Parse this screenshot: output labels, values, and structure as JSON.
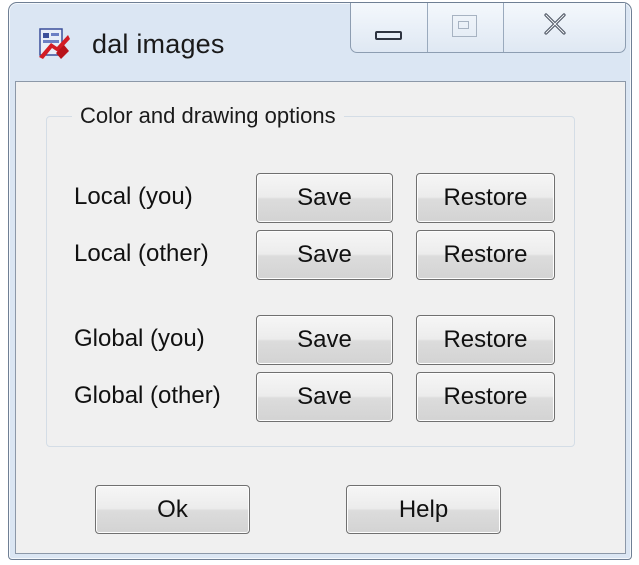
{
  "window": {
    "title": "dal images",
    "icon": "dal-app-icon",
    "controls": {
      "minimize": "minimize-icon",
      "maximize": "maximize-icon",
      "close": "close-icon"
    }
  },
  "group": {
    "legend": "Color and drawing options",
    "rows": [
      {
        "label": "Local (you)",
        "save": "Save",
        "restore": "Restore"
      },
      {
        "label": "Local (other)",
        "save": "Save",
        "restore": "Restore"
      },
      {
        "label": "Global (you)",
        "save": "Save",
        "restore": "Restore"
      },
      {
        "label": "Global (other)",
        "save": "Save",
        "restore": "Restore"
      }
    ]
  },
  "footer": {
    "ok_label": "Ok",
    "help_label": "Help"
  },
  "colors": {
    "frame": "#dbe6f3",
    "client": "#f0f0f0",
    "button_border": "#707070"
  }
}
